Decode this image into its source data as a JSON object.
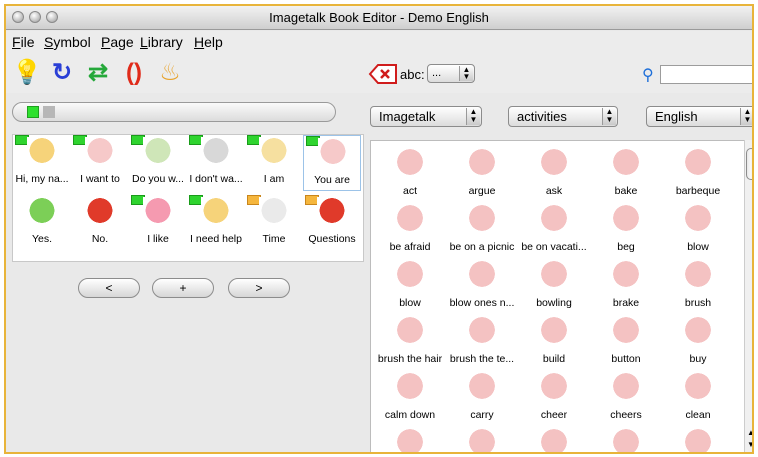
{
  "window": {
    "title": "Imagetalk Book Editor - Demo English"
  },
  "menu": [
    {
      "label": "File",
      "accel": "F",
      "rest": "ile"
    },
    {
      "label": "Symbol",
      "accel": "S",
      "rest": "ymbol"
    },
    {
      "label": "Page",
      "accel": "P",
      "rest": "age"
    },
    {
      "label": "Library",
      "accel": "L",
      "rest": "ibrary"
    },
    {
      "label": "Help",
      "accel": "H",
      "rest": "elp"
    }
  ],
  "toolbar": {
    "abc_label": "abc:",
    "abc_value": "...",
    "search_placeholder": ""
  },
  "filters": {
    "library": "Imagetalk",
    "category": "activities",
    "language": "English"
  },
  "page": {
    "items": [
      {
        "label": "Hi, my na...",
        "marker": "flag"
      },
      {
        "label": "I want to",
        "marker": "flag"
      },
      {
        "label": "Do you w...",
        "marker": "flag"
      },
      {
        "label": "I don't wa...",
        "marker": "flag"
      },
      {
        "label": "I am",
        "marker": "flag"
      },
      {
        "label": "You are",
        "marker": "flag"
      },
      {
        "label": "Yes.",
        "marker": ""
      },
      {
        "label": "No.",
        "marker": ""
      },
      {
        "label": "I like",
        "marker": "flag"
      },
      {
        "label": "I need help",
        "marker": "flag"
      },
      {
        "label": "Time",
        "marker": "folder"
      },
      {
        "label": "Questions",
        "marker": "folder"
      }
    ],
    "nav": {
      "prev": "<",
      "add": "+",
      "next": ">"
    }
  },
  "library": {
    "symbols": [
      "act",
      "argue",
      "ask",
      "bake",
      "barbeque",
      "be afraid",
      "be on a picnic",
      "be on vacati...",
      "beg",
      "blow",
      "blow",
      "blow ones n...",
      "bowling",
      "brake",
      "brush",
      "brush the hair",
      "brush the te...",
      "build",
      "button",
      "buy",
      "calm down",
      "carry",
      "cheer",
      "cheers",
      "clean",
      "",
      "",
      "",
      "",
      ""
    ]
  }
}
